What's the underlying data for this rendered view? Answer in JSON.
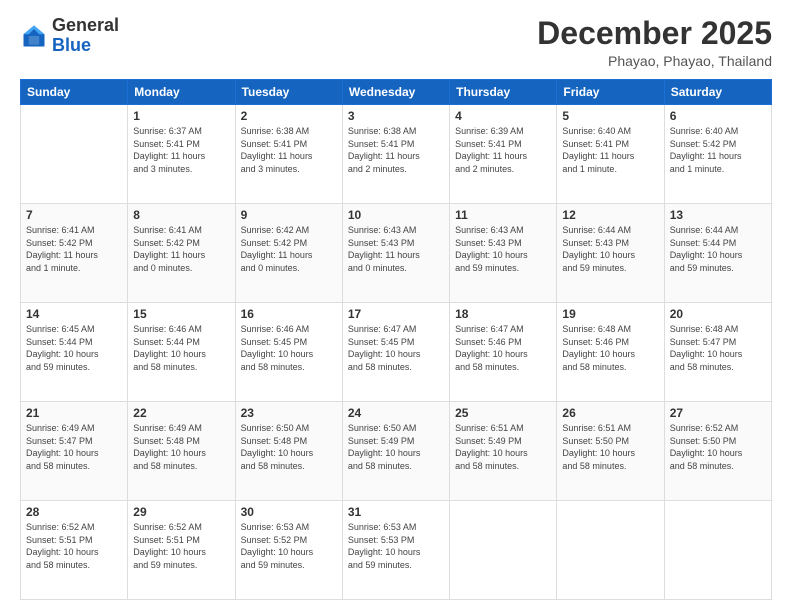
{
  "header": {
    "logo": {
      "general": "General",
      "blue": "Blue"
    },
    "title": "December 2025",
    "location": "Phayao, Phayao, Thailand"
  },
  "calendar": {
    "days_of_week": [
      "Sunday",
      "Monday",
      "Tuesday",
      "Wednesday",
      "Thursday",
      "Friday",
      "Saturday"
    ],
    "weeks": [
      [
        {
          "day": "",
          "info": ""
        },
        {
          "day": "1",
          "info": "Sunrise: 6:37 AM\nSunset: 5:41 PM\nDaylight: 11 hours\nand 3 minutes."
        },
        {
          "day": "2",
          "info": "Sunrise: 6:38 AM\nSunset: 5:41 PM\nDaylight: 11 hours\nand 3 minutes."
        },
        {
          "day": "3",
          "info": "Sunrise: 6:38 AM\nSunset: 5:41 PM\nDaylight: 11 hours\nand 2 minutes."
        },
        {
          "day": "4",
          "info": "Sunrise: 6:39 AM\nSunset: 5:41 PM\nDaylight: 11 hours\nand 2 minutes."
        },
        {
          "day": "5",
          "info": "Sunrise: 6:40 AM\nSunset: 5:41 PM\nDaylight: 11 hours\nand 1 minute."
        },
        {
          "day": "6",
          "info": "Sunrise: 6:40 AM\nSunset: 5:42 PM\nDaylight: 11 hours\nand 1 minute."
        }
      ],
      [
        {
          "day": "7",
          "info": "Sunrise: 6:41 AM\nSunset: 5:42 PM\nDaylight: 11 hours\nand 1 minute."
        },
        {
          "day": "8",
          "info": "Sunrise: 6:41 AM\nSunset: 5:42 PM\nDaylight: 11 hours\nand 0 minutes."
        },
        {
          "day": "9",
          "info": "Sunrise: 6:42 AM\nSunset: 5:42 PM\nDaylight: 11 hours\nand 0 minutes."
        },
        {
          "day": "10",
          "info": "Sunrise: 6:43 AM\nSunset: 5:43 PM\nDaylight: 11 hours\nand 0 minutes."
        },
        {
          "day": "11",
          "info": "Sunrise: 6:43 AM\nSunset: 5:43 PM\nDaylight: 10 hours\nand 59 minutes."
        },
        {
          "day": "12",
          "info": "Sunrise: 6:44 AM\nSunset: 5:43 PM\nDaylight: 10 hours\nand 59 minutes."
        },
        {
          "day": "13",
          "info": "Sunrise: 6:44 AM\nSunset: 5:44 PM\nDaylight: 10 hours\nand 59 minutes."
        }
      ],
      [
        {
          "day": "14",
          "info": "Sunrise: 6:45 AM\nSunset: 5:44 PM\nDaylight: 10 hours\nand 59 minutes."
        },
        {
          "day": "15",
          "info": "Sunrise: 6:46 AM\nSunset: 5:44 PM\nDaylight: 10 hours\nand 58 minutes."
        },
        {
          "day": "16",
          "info": "Sunrise: 6:46 AM\nSunset: 5:45 PM\nDaylight: 10 hours\nand 58 minutes."
        },
        {
          "day": "17",
          "info": "Sunrise: 6:47 AM\nSunset: 5:45 PM\nDaylight: 10 hours\nand 58 minutes."
        },
        {
          "day": "18",
          "info": "Sunrise: 6:47 AM\nSunset: 5:46 PM\nDaylight: 10 hours\nand 58 minutes."
        },
        {
          "day": "19",
          "info": "Sunrise: 6:48 AM\nSunset: 5:46 PM\nDaylight: 10 hours\nand 58 minutes."
        },
        {
          "day": "20",
          "info": "Sunrise: 6:48 AM\nSunset: 5:47 PM\nDaylight: 10 hours\nand 58 minutes."
        }
      ],
      [
        {
          "day": "21",
          "info": "Sunrise: 6:49 AM\nSunset: 5:47 PM\nDaylight: 10 hours\nand 58 minutes."
        },
        {
          "day": "22",
          "info": "Sunrise: 6:49 AM\nSunset: 5:48 PM\nDaylight: 10 hours\nand 58 minutes."
        },
        {
          "day": "23",
          "info": "Sunrise: 6:50 AM\nSunset: 5:48 PM\nDaylight: 10 hours\nand 58 minutes."
        },
        {
          "day": "24",
          "info": "Sunrise: 6:50 AM\nSunset: 5:49 PM\nDaylight: 10 hours\nand 58 minutes."
        },
        {
          "day": "25",
          "info": "Sunrise: 6:51 AM\nSunset: 5:49 PM\nDaylight: 10 hours\nand 58 minutes."
        },
        {
          "day": "26",
          "info": "Sunrise: 6:51 AM\nSunset: 5:50 PM\nDaylight: 10 hours\nand 58 minutes."
        },
        {
          "day": "27",
          "info": "Sunrise: 6:52 AM\nSunset: 5:50 PM\nDaylight: 10 hours\nand 58 minutes."
        }
      ],
      [
        {
          "day": "28",
          "info": "Sunrise: 6:52 AM\nSunset: 5:51 PM\nDaylight: 10 hours\nand 58 minutes."
        },
        {
          "day": "29",
          "info": "Sunrise: 6:52 AM\nSunset: 5:51 PM\nDaylight: 10 hours\nand 59 minutes."
        },
        {
          "day": "30",
          "info": "Sunrise: 6:53 AM\nSunset: 5:52 PM\nDaylight: 10 hours\nand 59 minutes."
        },
        {
          "day": "31",
          "info": "Sunrise: 6:53 AM\nSunset: 5:53 PM\nDaylight: 10 hours\nand 59 minutes."
        },
        {
          "day": "",
          "info": ""
        },
        {
          "day": "",
          "info": ""
        },
        {
          "day": "",
          "info": ""
        }
      ]
    ]
  }
}
